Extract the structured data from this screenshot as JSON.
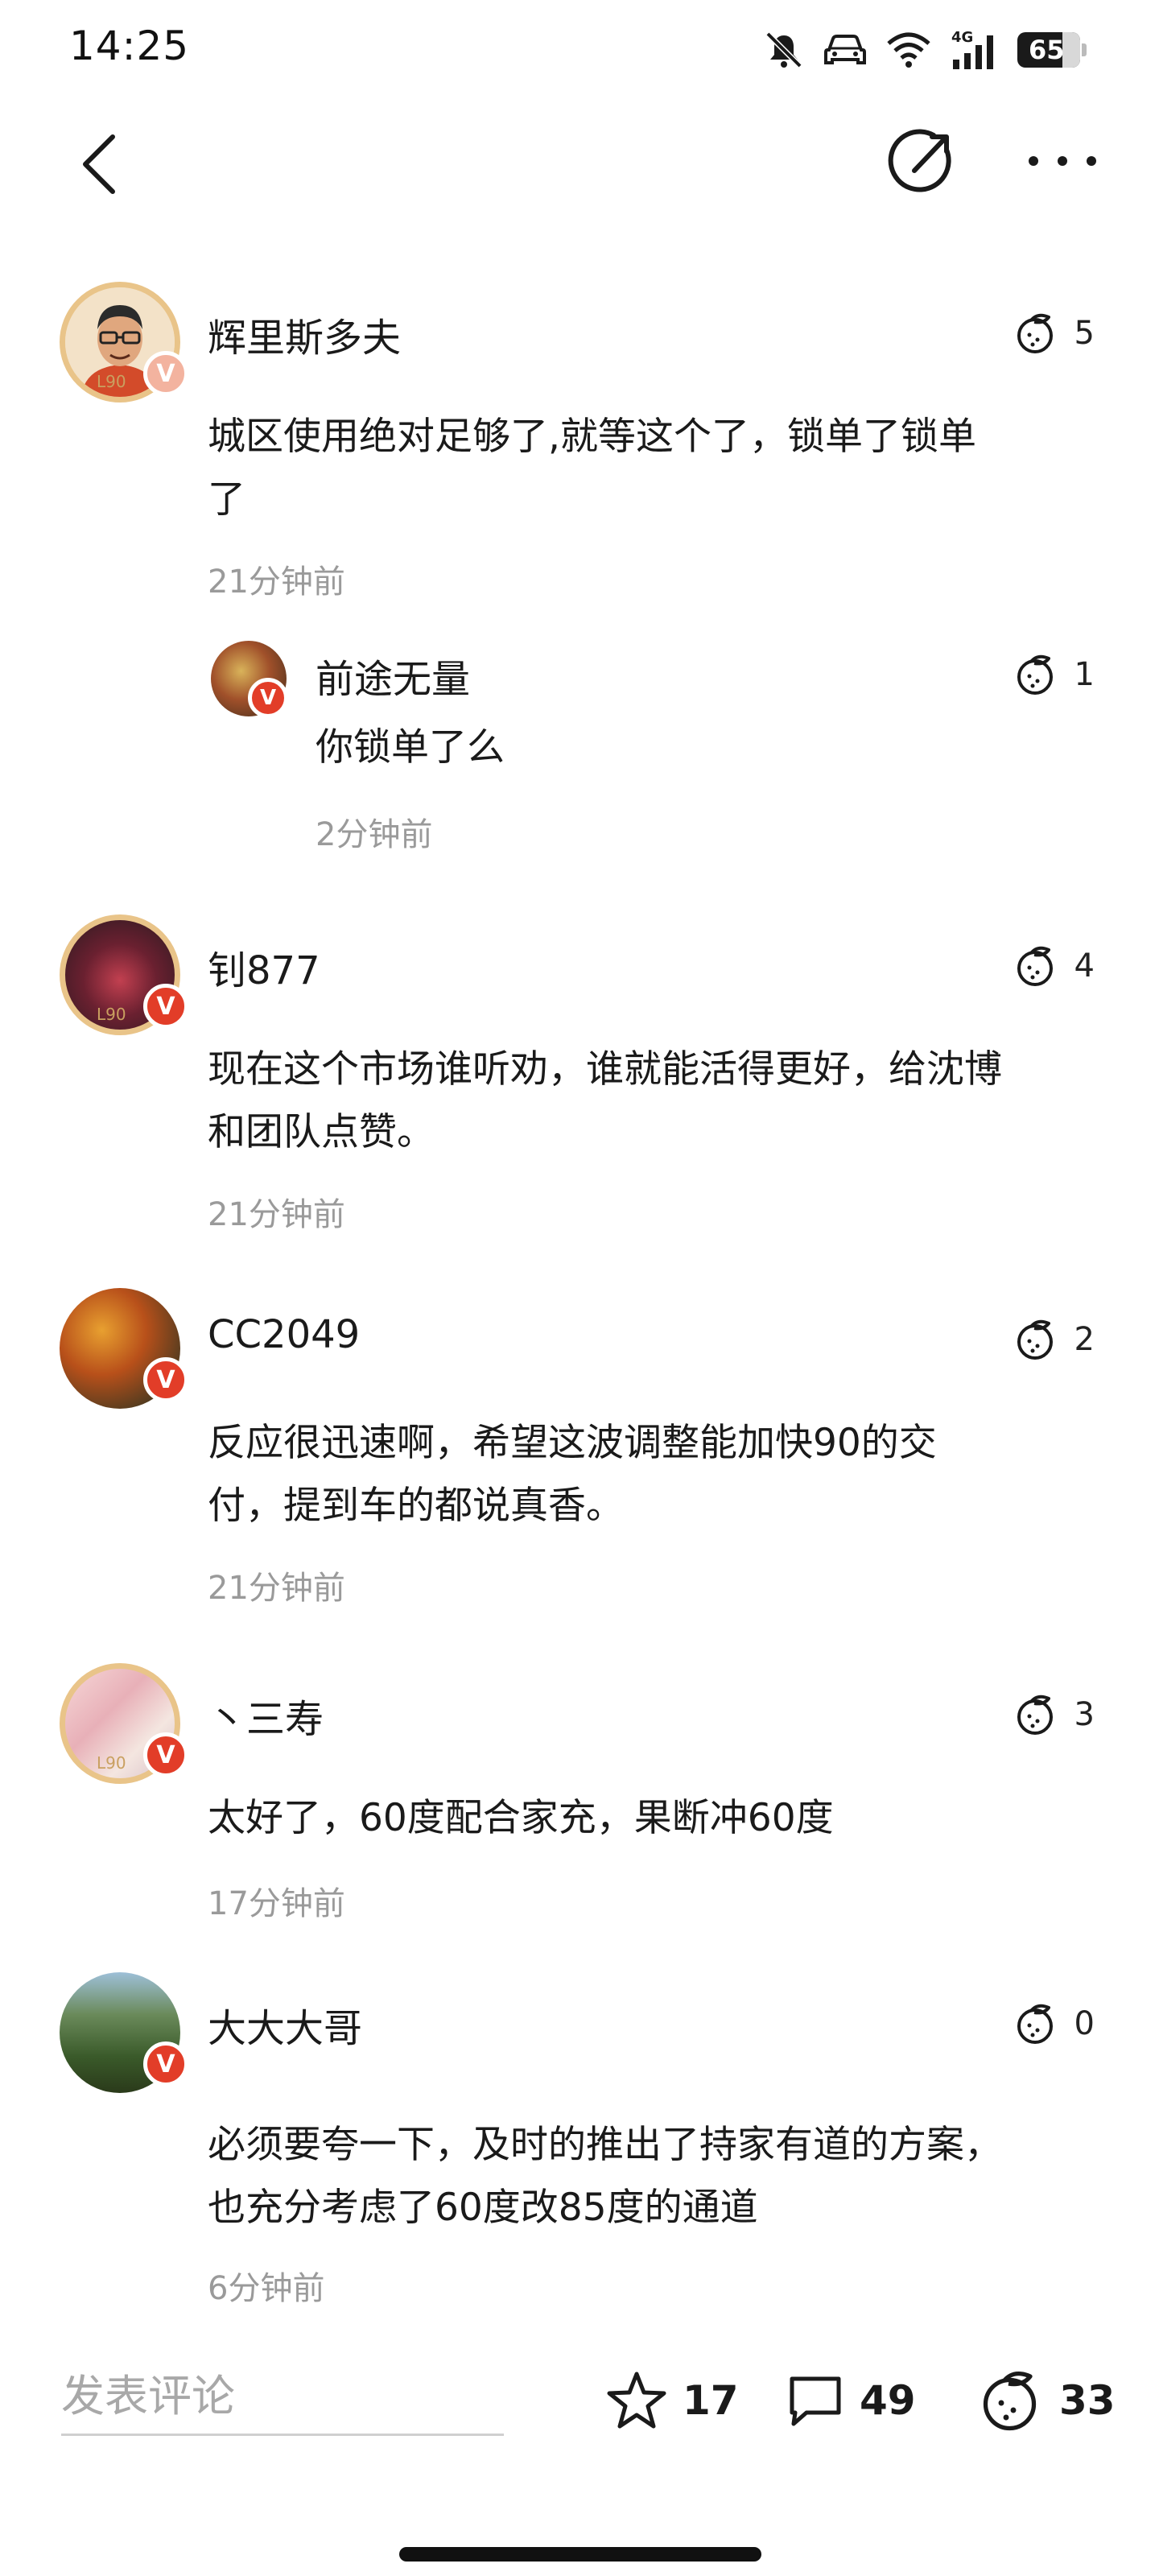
{
  "status_bar": {
    "time": "14:25",
    "battery": "65"
  },
  "nav": {
    "back": "back",
    "share": "share",
    "more": "more"
  },
  "comments": [
    {
      "user": "辉里斯多夫",
      "likes": "5",
      "text_lines": [
        "城区使用绝对足够了,就等这个了，锁单了锁单",
        "了"
      ],
      "time": "21分钟前",
      "level": "L90",
      "reply": {
        "user": "前途无量",
        "likes": "1",
        "text": "你锁单了么",
        "time": "2分钟前"
      }
    },
    {
      "user": "钊877",
      "likes": "4",
      "text_lines": [
        "现在这个市场谁听劝，谁就能活得更好，给沈博",
        "和团队点赞。"
      ],
      "time": "21分钟前",
      "level": "L90"
    },
    {
      "user": "CC2049",
      "likes": "2",
      "text_lines": [
        "反应很迅速啊，希望这波调整能加快90的交",
        "付，提到车的都说真香。"
      ],
      "time": "21分钟前"
    },
    {
      "user": "丶三寿",
      "likes": "3",
      "text_lines": [
        "太好了，60度配合家充，果断冲60度"
      ],
      "time": "17分钟前",
      "level": "L90"
    },
    {
      "user": "大大大哥",
      "likes": "0",
      "text_lines": [
        "必须要夸一下，及时的推出了持家有道的方案，",
        "也充分考虑了60度改85度的通道"
      ],
      "time": "6分钟前"
    }
  ],
  "bottom_bar": {
    "placeholder": "发表评论",
    "favorites": "17",
    "comments": "49",
    "likes": "33"
  },
  "colors": {
    "badge": "#e23d28",
    "ring": "#e9c489",
    "muted": "#9a9a9a"
  }
}
